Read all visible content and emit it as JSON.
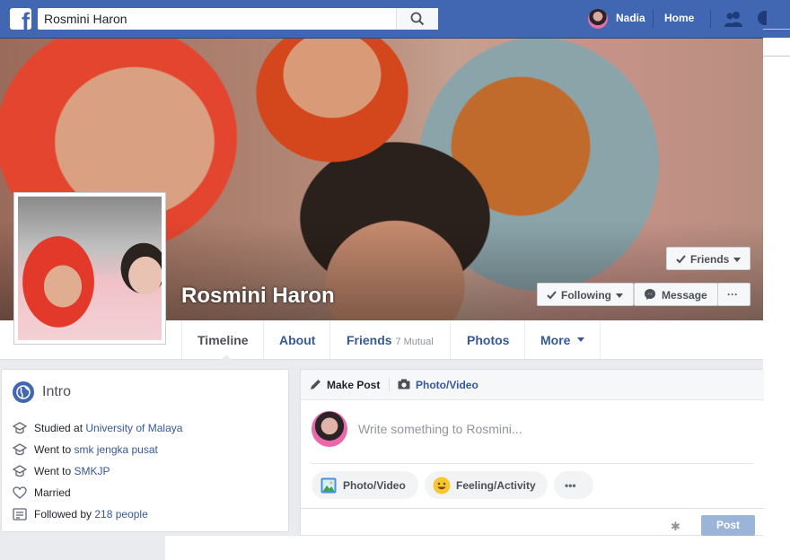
{
  "topbar": {
    "search_value": "Rosmini Haron",
    "user_name": "Nadia",
    "home_label": "Home",
    "colors": {
      "brand": "#4267b2"
    }
  },
  "profile": {
    "name": "Rosmini Haron",
    "buttons": {
      "friends": "Friends",
      "following": "Following",
      "message": "Message",
      "more": "···"
    }
  },
  "nav": {
    "tabs": [
      {
        "label": "Timeline"
      },
      {
        "label": "About"
      },
      {
        "label": "Friends",
        "badge": "7 Mutual"
      },
      {
        "label": "Photos"
      },
      {
        "label": "More"
      }
    ]
  },
  "intro": {
    "title": "Intro",
    "items": [
      {
        "icon": "graduation-cap-icon",
        "prefix": "Studied at ",
        "link": "University of Malaya"
      },
      {
        "icon": "graduation-cap-icon",
        "prefix": "Went to ",
        "link": "smk jengka pusat"
      },
      {
        "icon": "graduation-cap-icon",
        "prefix": "Went to ",
        "link": "SMKJP"
      },
      {
        "icon": "heart-icon",
        "prefix": "Married",
        "link": ""
      },
      {
        "icon": "rss-feed-icon",
        "prefix": "Followed by ",
        "link": "218 people"
      }
    ]
  },
  "composer": {
    "tab_make_post": "Make Post",
    "tab_photo_video": "Photo/Video",
    "placeholder": "Write something to Rosmini...",
    "actions": [
      {
        "label": "Photo/Video"
      },
      {
        "label": "Feeling/Activity"
      },
      {
        "label": "•••"
      }
    ],
    "post_label": "Post"
  }
}
